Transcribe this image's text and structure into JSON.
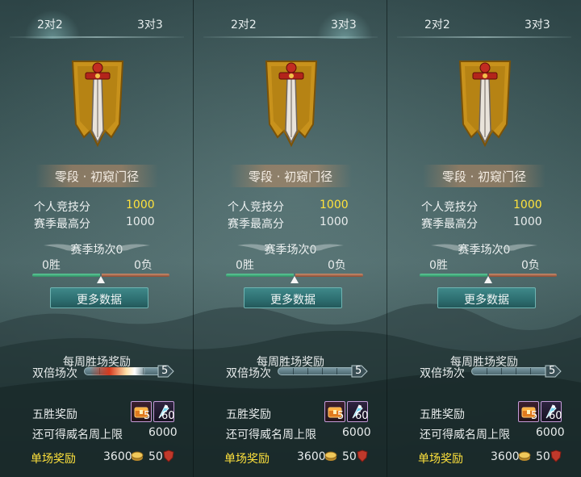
{
  "panels": [
    {
      "tabs": [
        "2对2",
        "3对3"
      ],
      "active_tab": "2对2",
      "rank_title": "零段 · 初窥门径",
      "stats": [
        {
          "label": "个人竞技分",
          "value": "1000"
        },
        {
          "label": "赛季最高分",
          "value": "1000"
        }
      ],
      "season": {
        "title": "赛季场次0",
        "wins": "0胜",
        "losses": "0负"
      },
      "more_button": "更多数据",
      "weekly": {
        "title": "每周胜场奖励",
        "double_label": "双倍场次",
        "double_count": "5"
      },
      "five_win": {
        "label": "五胜奖励",
        "item1_count": "5",
        "item2_count": "60"
      },
      "remaining": {
        "label": "还可得威名周上限",
        "value": "6000"
      },
      "single": {
        "label": "单场奖励",
        "coin_value": "3600",
        "shield_value": "50"
      }
    },
    {
      "tabs": [
        "2对2",
        "3对3"
      ],
      "active_tab": "3对3",
      "rank_title": "零段 · 初窥门径",
      "stats": [
        {
          "label": "个人竞技分",
          "value": "1000"
        },
        {
          "label": "赛季最高分",
          "value": "1000"
        }
      ],
      "season": {
        "title": "赛季场次0",
        "wins": "0胜",
        "losses": "0负"
      },
      "more_button": "更多数据",
      "weekly": {
        "title": "每周胜场奖励",
        "double_label": "双倍场次",
        "double_count": "5"
      },
      "five_win": {
        "label": "五胜奖励",
        "item1_count": "5",
        "item2_count": "60"
      },
      "remaining": {
        "label": "还可得威名周上限",
        "value": "6000"
      },
      "single": {
        "label": "单场奖励",
        "coin_value": "3600",
        "shield_value": "50"
      }
    },
    {
      "tabs": [
        "2对2",
        "3对3"
      ],
      "active_tab": "2对2",
      "rank_title": "零段 · 初窥门径",
      "stats": [
        {
          "label": "个人竞技分",
          "value": "1000"
        },
        {
          "label": "赛季最高分",
          "value": "1000"
        }
      ],
      "season": {
        "title": "赛季场次0",
        "wins": "0胜",
        "losses": "0负"
      },
      "more_button": "更多数据",
      "weekly": {
        "title": "每周胜场奖励",
        "double_label": "双倍场次",
        "double_count": "5"
      },
      "five_win": {
        "label": "五胜奖励",
        "item1_count": "5",
        "item2_count": "60"
      },
      "remaining": {
        "label": "还可得威名周上限",
        "value": "6000"
      },
      "single": {
        "label": "单场奖励",
        "coin_value": "3600",
        "shield_value": "50"
      }
    }
  ],
  "win_loss_ratio": 0.5,
  "double_progress": 0.7,
  "colors": {
    "highlight_yellow": "#ffe23c",
    "button_teal": "#2d6e70",
    "win_green": "#3fae7c",
    "loss_red": "#a0563a",
    "banner_gold": "#c8921c"
  },
  "icons": [
    "sword-banner-emblem",
    "chest-item-icon",
    "cone-item-icon",
    "coin-icon",
    "shield-icon"
  ]
}
